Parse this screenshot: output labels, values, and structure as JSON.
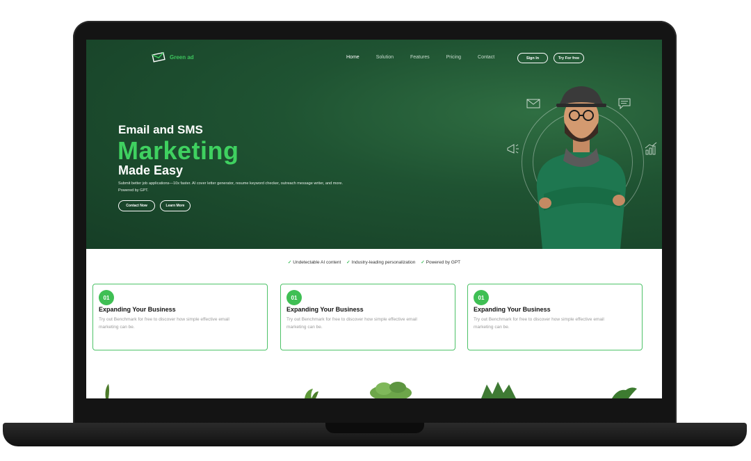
{
  "brand": {
    "name": "Green ad",
    "accent": "#3fd160",
    "hero_dark": "#163e26"
  },
  "nav": {
    "links": [
      "Home",
      "Solution",
      "Features",
      "Pricing",
      "Contact"
    ],
    "sign_in": "Sign In",
    "try_free": "Try For free"
  },
  "hero": {
    "title_pre": "Email and SMS",
    "title_main": "Marketing",
    "title_post": "Made Easy",
    "description": "Submit better job applications—10x faster. AI cover letter generator, resume keyword checker, outreach message writer, and more. Powered by GPT.",
    "contact_button": "Contact Now",
    "learn_button": "Learn More",
    "icons": [
      "mail-icon",
      "chat-icon",
      "megaphone-icon",
      "growth-chart-icon"
    ]
  },
  "features": [
    "Undetectable AI content",
    "Industry-leading personalization",
    "Powered by GPT"
  ],
  "cards": [
    {
      "number": "01",
      "title": "Expanding Your Business",
      "description": "Try out Benchmark for free to discover how simple effective email marketing can be."
    },
    {
      "number": "01",
      "title": "Expanding Your Business",
      "description": "Try out Benchmark for free to discover how simple effective email marketing can be."
    },
    {
      "number": "01",
      "title": "Expanding Your Business",
      "description": "Try out Benchmark for free to discover how simple effective email marketing can be."
    }
  ]
}
